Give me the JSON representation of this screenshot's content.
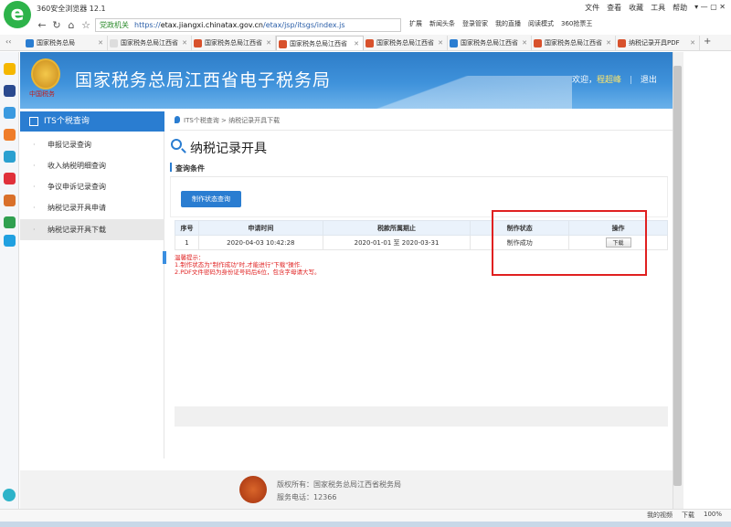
{
  "browser": {
    "title": "360安全浏览器 12.1",
    "menu": [
      "文件",
      "查看",
      "收藏",
      "工具",
      "帮助"
    ],
    "address_tag": "党政机关",
    "url_prefix": "https://",
    "url_domain": "etax.jiangxi.chinatax.gov.cn",
    "url_path": "/etax/jsp/itsgs/index.js",
    "nav_right": [
      "扩展",
      "新闻头条",
      "登录管家",
      "我的直播",
      "阅读模式",
      "360抢票王"
    ],
    "tabs": [
      {
        "label": "国家税务总局"
      },
      {
        "label": "国家税务总局江西省"
      },
      {
        "label": "国家税务总局江西省"
      },
      {
        "label": "国家税务总局江西省"
      },
      {
        "label": "国家税务总局江西省"
      },
      {
        "label": "国家税务总局江西省"
      },
      {
        "label": "国家税务总局江西省"
      },
      {
        "label": "纳税记录开具PDF"
      }
    ],
    "status_right": [
      "我的视频",
      "下载",
      "100%"
    ]
  },
  "header": {
    "emblem_text": "中国税务",
    "site_title": "国家税务总局江西省电子税务局",
    "welcome_prefix": "欢迎，",
    "username": "程超峰",
    "logout": "退出"
  },
  "sidebar": {
    "heading": "ITS个税查询",
    "items": [
      {
        "label": "申报记录查询"
      },
      {
        "label": "收入纳税明细查询"
      },
      {
        "label": "争议申诉记录查询"
      },
      {
        "label": "纳税记录开具申请"
      },
      {
        "label": "纳税记录开具下载"
      }
    ]
  },
  "main": {
    "breadcrumb": "ITS个税查询 > 纳税记录开具下载",
    "title": "纳税记录开具",
    "conditions_label": "查询条件",
    "status_query_button": "制作状态查询",
    "table": {
      "headers": [
        "序号",
        "申请时间",
        "税款所属期止",
        "制作状态",
        "操作"
      ],
      "rows": [
        {
          "no": "1",
          "time": "2020-04-03 10:42:28",
          "period": "2020-01-01 至 2020-03-31",
          "status": "制作成功",
          "action": "下载"
        }
      ]
    },
    "tips": [
      "温馨提示：",
      "1.制作状态为\"制作成功\"时,才能进行\"下载\"操作.",
      "2.PDF文件密码为身份证号码后6位，包含字母请大写。"
    ]
  },
  "footer": {
    "logo_text": "中国税务",
    "copyright": "版权所有：国家税务总局江西省税务局",
    "phone": "服务电话：12366"
  },
  "colors": {
    "accent": "#2a7dd1",
    "highlight": "#e02020"
  }
}
